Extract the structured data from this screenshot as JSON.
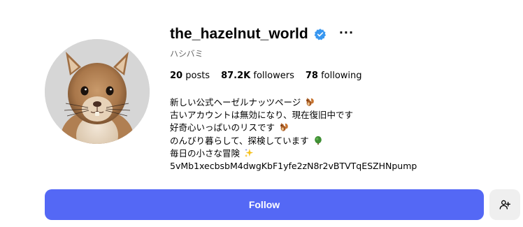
{
  "profile": {
    "username": "the_hazelnut_world",
    "full_name": "ハシバミ",
    "verified_icon": "verified-badge-icon",
    "more_label": "···",
    "avatar": "squirrel-photo"
  },
  "stats": {
    "posts_count": "20",
    "posts_label": "posts",
    "followers_count": "87.2K",
    "followers_label": "followers",
    "following_count": "78",
    "following_label": "following"
  },
  "bio": {
    "line1": "新しい公式ヘーゼルナッツページ",
    "line1_emoji": "squirrel-emoji",
    "line2": "古いアカウントは無効になり、現在復旧中です",
    "line3": "好奇心いっぱいのリスです",
    "line3_emoji": "squirrel-emoji",
    "line4": "のんびり暮らして、探検しています",
    "line4_emoji": "tree-emoji",
    "line5": "毎日の小さな冒険",
    "line5_emoji": "sparkles-emoji",
    "line6": "5vMb1xecbsbM4dwgKbF1yfe2zN8r2vBTVTqESZHNpump"
  },
  "actions": {
    "follow_label": "Follow",
    "add_user_icon": "person-add-icon"
  },
  "colors": {
    "follow_button": "#5468f5",
    "verified_badge": "#3897f0",
    "secondary_button": "#efefef"
  }
}
